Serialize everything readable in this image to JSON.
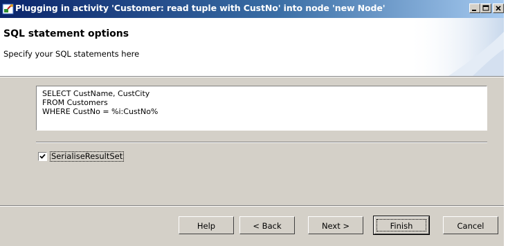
{
  "window": {
    "title": "Plugging in activity 'Customer: read tuple with CustNo' into node 'new Node'"
  },
  "header": {
    "title": "SQL statement options",
    "subtitle": "Specify your SQL statements here"
  },
  "sql": {
    "value": "SELECT CustName, CustCity\nFROM Customers\nWHERE CustNo = %i:CustNo%"
  },
  "options": {
    "serialise_label": "SerialiseResultSet",
    "serialise_checked": true
  },
  "buttons": {
    "help": "Help",
    "back": "< Back",
    "next": "Next >",
    "finish": "Finish",
    "cancel": "Cancel"
  },
  "colors": {
    "titlebar_start": "#0a246a",
    "titlebar_end": "#a6caf0",
    "face": "#d4d0c8"
  }
}
